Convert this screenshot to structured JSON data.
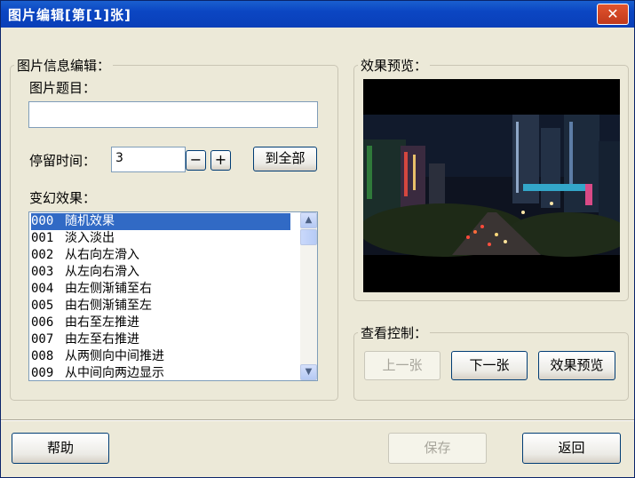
{
  "window": {
    "title": "图片编辑[第[1]张]",
    "close_glyph": "✕"
  },
  "info_group": {
    "legend": "图片信息编辑：",
    "title_label": "图片题目：",
    "title_value": "",
    "stay_label": "停留时间：",
    "stay_value": "3",
    "minus_label": "−",
    "plus_label": "+",
    "apply_all_label": "到全部",
    "effect_label": "变幻效果：",
    "effects": [
      {
        "num": "000",
        "name": "随机效果",
        "selected": true
      },
      {
        "num": "001",
        "name": "淡入淡出"
      },
      {
        "num": "002",
        "name": "从右向左滑入"
      },
      {
        "num": "003",
        "name": "从左向右滑入"
      },
      {
        "num": "004",
        "name": "由左侧渐铺至右"
      },
      {
        "num": "005",
        "name": "由右侧渐铺至左"
      },
      {
        "num": "006",
        "name": "由右至左推进"
      },
      {
        "num": "007",
        "name": "由左至右推进"
      },
      {
        "num": "008",
        "name": "从两侧向中间推进"
      },
      {
        "num": "009",
        "name": "从中间向两边显示"
      }
    ],
    "scroll_up_glyph": "▲",
    "scroll_down_glyph": "▼"
  },
  "preview_group": {
    "legend": "效果预览："
  },
  "control_group": {
    "legend": "查看控制：",
    "prev_label": "上一张",
    "next_label": "下一张",
    "preview_label": "效果预览"
  },
  "footer": {
    "help_label": "帮助",
    "save_label": "保存",
    "back_label": "返回"
  },
  "colors": {
    "title_bar": "#0b46c3",
    "selection": "#316ac5",
    "dialog_bg": "#ece9d8"
  }
}
